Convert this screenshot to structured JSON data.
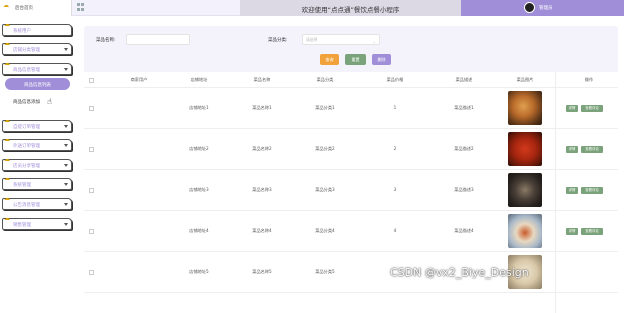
{
  "header": {
    "brand_label": "后台首页",
    "welcome": "欢迎使用“点点通”餐饮点餐小程序",
    "username": "管理员"
  },
  "sidebar": {
    "items": [
      {
        "label": "系统用户"
      },
      {
        "label": "店铺分类管理"
      },
      {
        "label": "商品信息管理"
      },
      {
        "label": "自提订单管理"
      },
      {
        "label": "外送订单管理"
      },
      {
        "label": "店员分享管理"
      },
      {
        "label": "系统管理"
      },
      {
        "label": "公告消息管理"
      },
      {
        "label": "销售管理"
      }
    ],
    "submenu": {
      "active": "商品信息列表",
      "item": "商品信息添加"
    }
  },
  "search": {
    "name_label": "菜品名称:",
    "name_placeholder": "",
    "category_label": "菜品分类:",
    "category_placeholder": "请选择",
    "query_btn": "查询",
    "reset_btn": "重置",
    "delete_btn": "删除"
  },
  "table": {
    "columns": [
      "商家用户",
      "店铺地址",
      "菜品名称",
      "菜品分类",
      "菜品价格",
      "菜品描述",
      "菜品图片",
      "操作"
    ],
    "rows": [
      {
        "user": "",
        "address": "店铺地址1",
        "name": "菜品名称1",
        "category": "菜品分类1",
        "price": "1",
        "desc": "菜品描述1"
      },
      {
        "user": "",
        "address": "店铺地址2",
        "name": "菜品名称2",
        "category": "菜品分类2",
        "price": "2",
        "desc": "菜品描述2"
      },
      {
        "user": "",
        "address": "店铺地址3",
        "name": "菜品名称3",
        "category": "菜品分类3",
        "price": "3",
        "desc": "菜品描述3"
      },
      {
        "user": "",
        "address": "店铺地址4",
        "name": "菜品名称4",
        "category": "菜品分类4",
        "price": "4",
        "desc": "菜品描述4"
      },
      {
        "user": "",
        "address": "店铺地址5",
        "name": "菜品名称5",
        "category": "菜品分类5",
        "price": "",
        "desc": ""
      }
    ],
    "action_detail": "详情",
    "action_review": "查看评论"
  },
  "watermark": "CSDN @vx2_Biye_Design",
  "colors": {
    "accent": "#a08fd8",
    "query": "#f2a23a",
    "reset": "#7ba37b"
  }
}
